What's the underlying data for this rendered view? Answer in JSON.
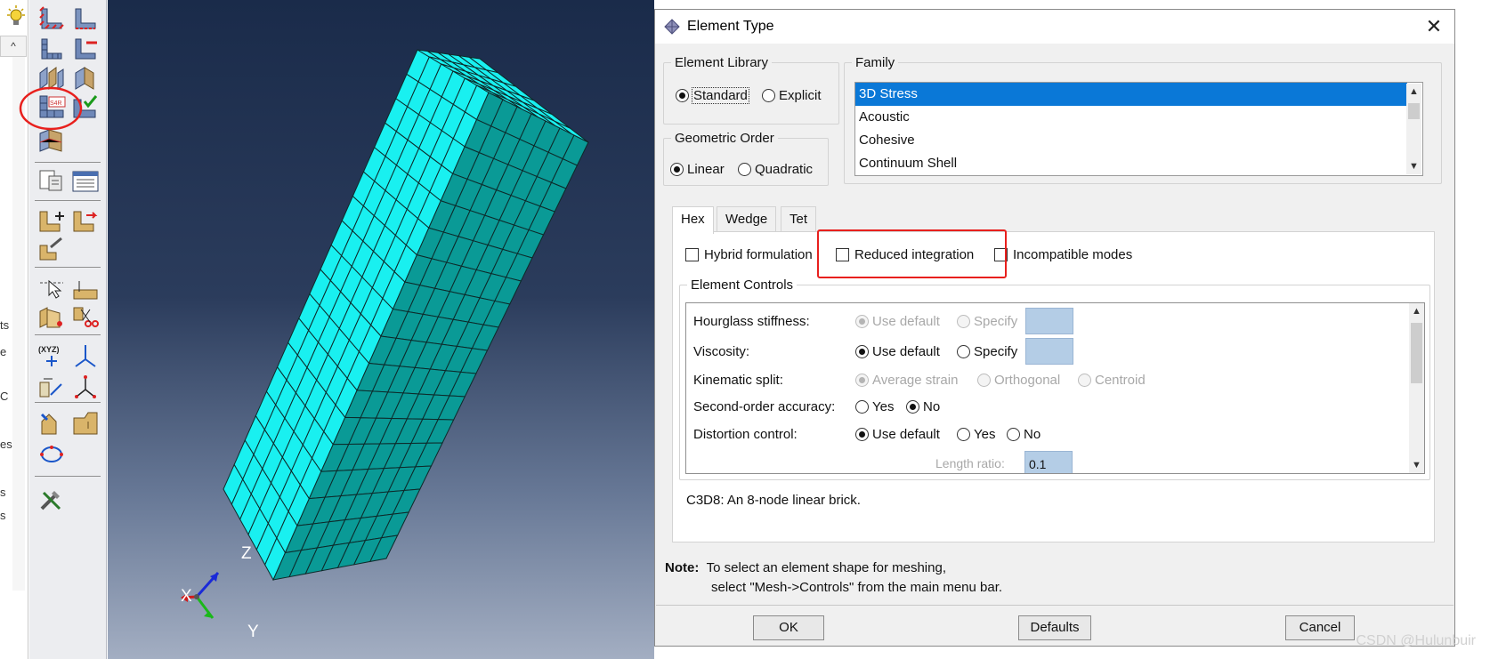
{
  "left_fragments": [
    "ts",
    "e",
    "C",
    "es",
    "s",
    "s"
  ],
  "left_scroll_up": "^",
  "toolbox": {
    "tools": [
      "seed-part-icon",
      "seed-edge-icon",
      "mesh-part-icon",
      "delete-mesh-icon",
      "assign-mesh-controls-icon",
      "mesh-region-icon",
      "assign-element-type-icon",
      "verify-mesh-icon",
      "mesh-stack-icon",
      "query-icon",
      "table-icon",
      "create-feature-icon",
      "edit-feature-icon",
      "virtual-topology-icon",
      "select-icon",
      "partition-icon",
      "partition-face-icon",
      "cut-icon",
      "datum-point-icon",
      "datum-axis-icon",
      "datum-plane-icon",
      "datum-csys-icon",
      "edit-mesh-icon",
      "repair-icon",
      "adaptivity-icon",
      "tools-icon"
    ]
  },
  "viewport": {
    "triad": {
      "x": "X",
      "y": "Y",
      "z": "Z"
    }
  },
  "dialog": {
    "title": "Element Type",
    "close": "✕",
    "element_library": {
      "legend": "Element Library",
      "options": [
        "Standard",
        "Explicit"
      ],
      "selected": "Standard"
    },
    "geometric_order": {
      "legend": "Geometric Order",
      "options": [
        "Linear",
        "Quadratic"
      ],
      "selected": "Linear"
    },
    "family": {
      "legend": "Family",
      "items": [
        "3D Stress",
        "Acoustic",
        "Cohesive",
        "Continuum Shell"
      ],
      "selected": "3D Stress"
    },
    "tabs": [
      "Hex",
      "Wedge",
      "Tet"
    ],
    "active_tab": "Hex",
    "options": {
      "hybrid": "Hybrid formulation",
      "reduced": "Reduced integration",
      "incompatible": "Incompatible modes"
    },
    "element_controls": {
      "legend": "Element Controls",
      "hourglass": {
        "label": "Hourglass stiffness:",
        "use_default": "Use default",
        "specify": "Specify"
      },
      "viscosity": {
        "label": "Viscosity:",
        "use_default": "Use default",
        "specify": "Specify"
      },
      "kinematic": {
        "label": "Kinematic split:",
        "average": "Average strain",
        "orthogonal": "Orthogonal",
        "centroid": "Centroid"
      },
      "second_order": {
        "label": "Second-order accuracy:",
        "yes": "Yes",
        "no": "No"
      },
      "distortion": {
        "label": "Distortion control:",
        "use_default": "Use default",
        "yes": "Yes",
        "no": "No"
      },
      "length_ratio": {
        "label": "Length ratio:",
        "value": "0.1"
      }
    },
    "description": "C3D8:  An 8-node linear brick.",
    "note": {
      "label": "Note:",
      "line1": "To select an element shape for meshing,",
      "line2": "select \"Mesh->Controls\" from the main menu bar."
    },
    "buttons": {
      "ok": "OK",
      "defaults": "Defaults",
      "cancel": "Cancel"
    }
  },
  "watermark": "CSDN @Hulunbuir",
  "colors": {
    "mesh_face_light": "#19f0f0",
    "mesh_face_dark": "#0a9a96",
    "selection_blue": "#0a78d7",
    "highlight_red": "#e8201d"
  }
}
